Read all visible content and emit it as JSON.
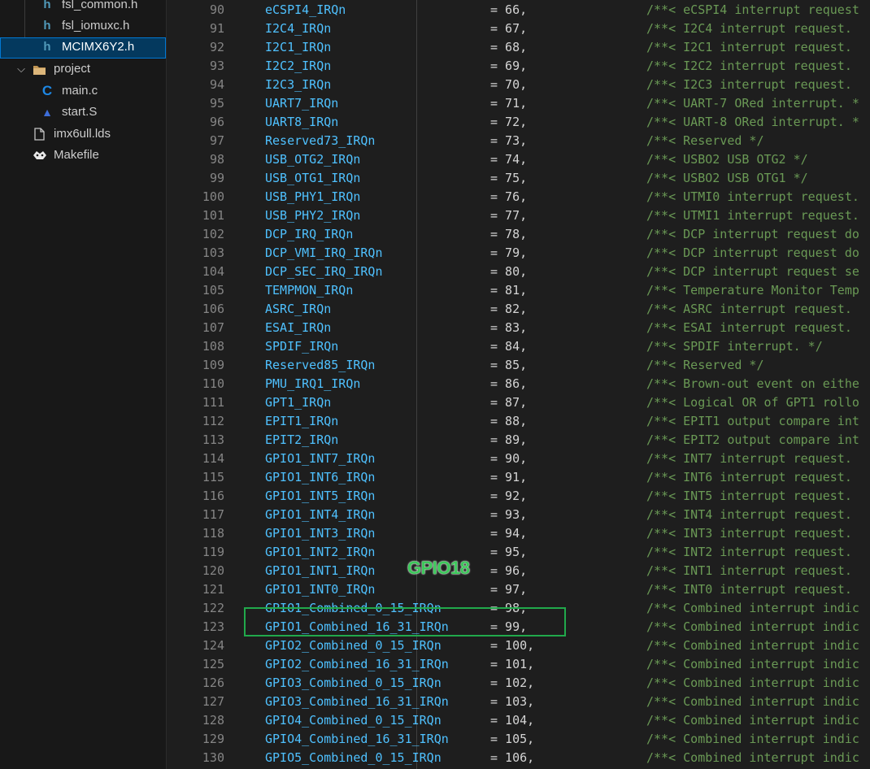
{
  "explorer": {
    "items": [
      {
        "label": "fsl_common.h",
        "icon": "h-file-icon",
        "glyph": "h",
        "depth": 2
      },
      {
        "label": "fsl_iomuxc.h",
        "icon": "h-file-icon",
        "glyph": "h",
        "depth": 2
      },
      {
        "label": "MCIMX6Y2.h",
        "icon": "h-file-icon",
        "glyph": "h",
        "depth": 2,
        "selected": true
      },
      {
        "label": "project",
        "icon": "folder-icon",
        "glyph": "",
        "depth": 1,
        "folder": true
      },
      {
        "label": "main.c",
        "icon": "c-file-icon",
        "glyph": "C",
        "depth": 2
      },
      {
        "label": "start.S",
        "icon": "asm-file-icon",
        "glyph": "▲",
        "depth": 2
      },
      {
        "label": "imx6ull.lds",
        "icon": "file-icon",
        "glyph": "",
        "depth": 1
      },
      {
        "label": "Makefile",
        "icon": "makefile-icon",
        "glyph": "",
        "depth": 1
      }
    ]
  },
  "editor": {
    "lines": [
      {
        "n": "90",
        "name": "eCSPI4_IRQn",
        "val": "= 66,",
        "comment": "/**< eCSPI4 interrupt request"
      },
      {
        "n": "91",
        "name": "I2C4_IRQn",
        "val": "= 67,",
        "comment": "/**< I2C4 interrupt request."
      },
      {
        "n": "92",
        "name": "I2C1_IRQn",
        "val": "= 68,",
        "comment": "/**< I2C1 interrupt request."
      },
      {
        "n": "93",
        "name": "I2C2_IRQn",
        "val": "= 69,",
        "comment": "/**< I2C2 interrupt request."
      },
      {
        "n": "94",
        "name": "I2C3_IRQn",
        "val": "= 70,",
        "comment": "/**< I2C3 interrupt request."
      },
      {
        "n": "95",
        "name": "UART7_IRQn",
        "val": "= 71,",
        "comment": "/**< UART-7 ORed interrupt. *"
      },
      {
        "n": "96",
        "name": "UART8_IRQn",
        "val": "= 72,",
        "comment": "/**< UART-8 ORed interrupt. *"
      },
      {
        "n": "97",
        "name": "Reserved73_IRQn",
        "val": "= 73,",
        "comment": "/**< Reserved */"
      },
      {
        "n": "98",
        "name": "USB_OTG2_IRQn",
        "val": "= 74,",
        "comment": "/**< USBO2 USB OTG2 */"
      },
      {
        "n": "99",
        "name": "USB_OTG1_IRQn",
        "val": "= 75,",
        "comment": "/**< USBO2 USB OTG1 */"
      },
      {
        "n": "100",
        "name": "USB_PHY1_IRQn",
        "val": "= 76,",
        "comment": "/**< UTMI0 interrupt request."
      },
      {
        "n": "101",
        "name": "USB_PHY2_IRQn",
        "val": "= 77,",
        "comment": "/**< UTMI1 interrupt request."
      },
      {
        "n": "102",
        "name": "DCP_IRQ_IRQn",
        "val": "= 78,",
        "comment": "/**< DCP interrupt request do"
      },
      {
        "n": "103",
        "name": "DCP_VMI_IRQ_IRQn",
        "val": "= 79,",
        "comment": "/**< DCP interrupt request do"
      },
      {
        "n": "104",
        "name": "DCP_SEC_IRQ_IRQn",
        "val": "= 80,",
        "comment": "/**< DCP interrupt request se"
      },
      {
        "n": "105",
        "name": "TEMPMON_IRQn",
        "val": "= 81,",
        "comment": "/**< Temperature Monitor Temp"
      },
      {
        "n": "106",
        "name": "ASRC_IRQn",
        "val": "= 82,",
        "comment": "/**< ASRC interrupt request."
      },
      {
        "n": "107",
        "name": "ESAI_IRQn",
        "val": "= 83,",
        "comment": "/**< ESAI interrupt request."
      },
      {
        "n": "108",
        "name": "SPDIF_IRQn",
        "val": "= 84,",
        "comment": "/**< SPDIF interrupt. */"
      },
      {
        "n": "109",
        "name": "Reserved85_IRQn",
        "val": "= 85,",
        "comment": "/**< Reserved */"
      },
      {
        "n": "110",
        "name": "PMU_IRQ1_IRQn",
        "val": "= 86,",
        "comment": "/**< Brown-out event on eithe"
      },
      {
        "n": "111",
        "name": "GPT1_IRQn",
        "val": "= 87,",
        "comment": "/**< Logical OR of GPT1 rollo"
      },
      {
        "n": "112",
        "name": "EPIT1_IRQn",
        "val": "= 88,",
        "comment": "/**< EPIT1 output compare int"
      },
      {
        "n": "113",
        "name": "EPIT2_IRQn",
        "val": "= 89,",
        "comment": "/**< EPIT2 output compare int"
      },
      {
        "n": "114",
        "name": "GPIO1_INT7_IRQn",
        "val": "= 90,",
        "comment": "/**< INT7 interrupt request."
      },
      {
        "n": "115",
        "name": "GPIO1_INT6_IRQn",
        "val": "= 91,",
        "comment": "/**< INT6 interrupt request."
      },
      {
        "n": "116",
        "name": "GPIO1_INT5_IRQn",
        "val": "= 92,",
        "comment": "/**< INT5 interrupt request."
      },
      {
        "n": "117",
        "name": "GPIO1_INT4_IRQn",
        "val": "= 93,",
        "comment": "/**< INT4 interrupt request."
      },
      {
        "n": "118",
        "name": "GPIO1_INT3_IRQn",
        "val": "= 94,",
        "comment": "/**< INT3 interrupt request."
      },
      {
        "n": "119",
        "name": "GPIO1_INT2_IRQn",
        "val": "= 95,",
        "comment": "/**< INT2 interrupt request."
      },
      {
        "n": "120",
        "name": "GPIO1_INT1_IRQn",
        "val": "= 96,",
        "comment": "/**< INT1 interrupt request."
      },
      {
        "n": "121",
        "name": "GPIO1_INT0_IRQn",
        "val": "= 97,",
        "comment": "/**< INT0 interrupt request."
      },
      {
        "n": "122",
        "name": "GPIO1_Combined_0_15_IRQn",
        "val": "= 98,",
        "comment": "/**< Combined interrupt indic"
      },
      {
        "n": "123",
        "name": "GPIO1_Combined_16_31_IRQn",
        "val": "= 99,",
        "comment": "/**< Combined interrupt indic"
      },
      {
        "n": "124",
        "name": "GPIO2_Combined_0_15_IRQn",
        "val": "= 100,",
        "comment": "/**< Combined interrupt indic"
      },
      {
        "n": "125",
        "name": "GPIO2_Combined_16_31_IRQn",
        "val": "= 101,",
        "comment": "/**< Combined interrupt indic"
      },
      {
        "n": "126",
        "name": "GPIO3_Combined_0_15_IRQn",
        "val": "= 102,",
        "comment": "/**< Combined interrupt indic"
      },
      {
        "n": "127",
        "name": "GPIO3_Combined_16_31_IRQn",
        "val": "= 103,",
        "comment": "/**< Combined interrupt indic"
      },
      {
        "n": "128",
        "name": "GPIO4_Combined_0_15_IRQn",
        "val": "= 104,",
        "comment": "/**< Combined interrupt indic"
      },
      {
        "n": "129",
        "name": "GPIO4_Combined_16_31_IRQn",
        "val": "= 105,",
        "comment": "/**< Combined interrupt indic"
      },
      {
        "n": "130",
        "name": "GPIO5_Combined_0_15_IRQn",
        "val": "= 106,",
        "comment": "/**< Combined interrupt indic"
      }
    ]
  },
  "annotation": {
    "label": "GPIO18",
    "color": "#21a94b"
  },
  "theme": {
    "identifier_color": "#4fc1ff",
    "comment_color": "#6a9955",
    "line_number_color": "#858585",
    "selection_color": "#04395e"
  }
}
